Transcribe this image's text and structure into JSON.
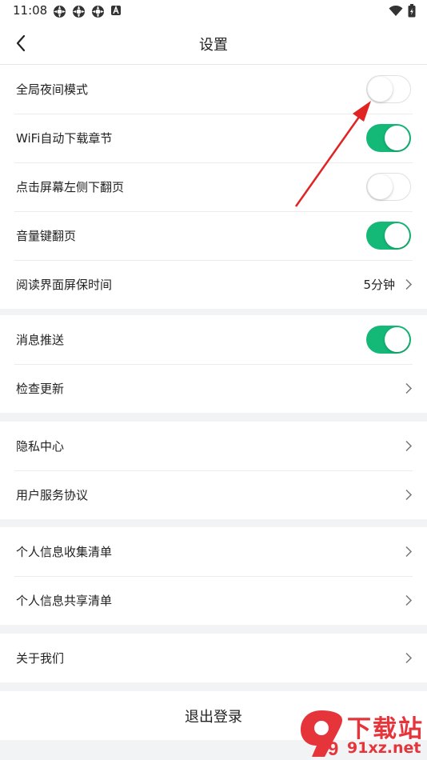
{
  "status_bar": {
    "time": "11:08",
    "icons": [
      "app-icon",
      "app-icon",
      "app-icon",
      "a-badge-icon",
      "wifi-icon",
      "battery-icon"
    ]
  },
  "header": {
    "title": "设置",
    "back_icon": "chevron-left-icon"
  },
  "groups": [
    {
      "items": [
        {
          "label": "全局夜间模式",
          "control": "toggle",
          "on": false
        },
        {
          "label": "WiFi自动下载章节",
          "control": "toggle",
          "on": true
        },
        {
          "label": "点击屏幕左侧下翻页",
          "control": "toggle",
          "on": false
        },
        {
          "label": "音量键翻页",
          "control": "toggle",
          "on": true
        },
        {
          "label": "阅读界面屏保时间",
          "control": "value",
          "value": "5分钟"
        }
      ]
    },
    {
      "items": [
        {
          "label": "消息推送",
          "control": "toggle",
          "on": true
        },
        {
          "label": "检查更新",
          "control": "chevron"
        }
      ]
    },
    {
      "items": [
        {
          "label": "隐私中心",
          "control": "chevron"
        },
        {
          "label": "用户服务协议",
          "control": "chevron"
        }
      ]
    },
    {
      "items": [
        {
          "label": "个人信息收集清单",
          "control": "chevron"
        },
        {
          "label": "个人信息共享清单",
          "control": "chevron"
        }
      ]
    },
    {
      "items": [
        {
          "label": "关于我们",
          "control": "chevron"
        }
      ]
    }
  ],
  "logout": {
    "label": "退出登录"
  },
  "colors": {
    "accent": "#14b978",
    "annotation_arrow": "#e02424",
    "watermark": "#e6343b"
  },
  "watermark": {
    "brand": "下载站",
    "url": "91xz.net",
    "logo_text": "9"
  }
}
